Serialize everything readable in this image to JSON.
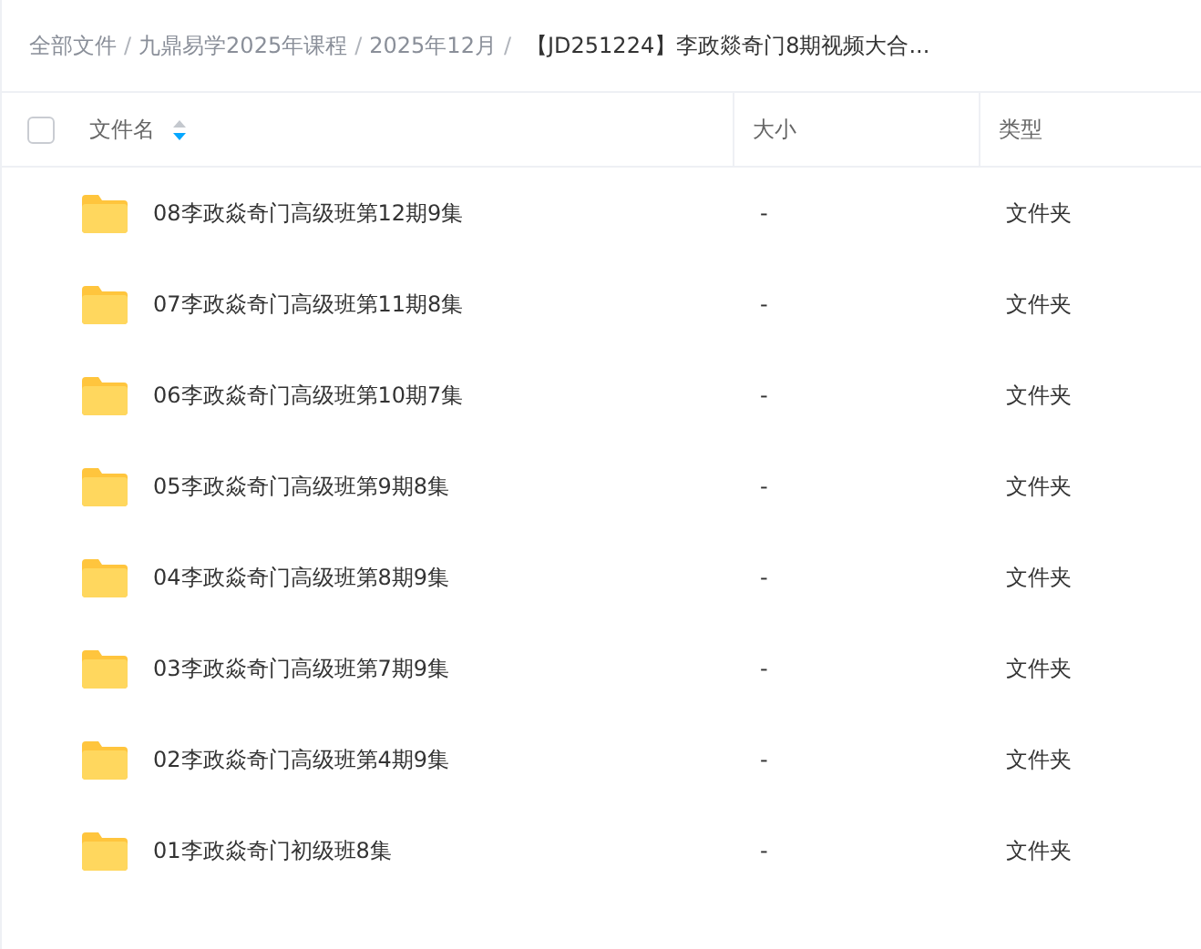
{
  "breadcrumb": [
    "全部文件",
    "九鼎易学2025年课程",
    "2025年12月"
  ],
  "breadcrumb_separator": "/",
  "breadcrumb_current": "【JD251224】李政燚奇门8期视频大合...",
  "table": {
    "select_all": {
      "checked": false
    },
    "columns": [
      {
        "label": "文件名"
      },
      {
        "label": "大小"
      },
      {
        "label": "类型"
      }
    ],
    "sort_descending": true,
    "rows": [
      {
        "name": "08李政焱奇门高级班第12期9集",
        "size": "-",
        "type": "文件夹"
      },
      {
        "name": "07李政焱奇门高级班第11期8集",
        "size": "-",
        "type": "文件夹"
      },
      {
        "name": "06李政焱奇门高级班第10期7集",
        "size": "-",
        "type": "文件夹"
      },
      {
        "name": "05李政焱奇门高级班第9期8集",
        "size": "-",
        "type": "文件夹"
      },
      {
        "name": "04李政焱奇门高级班第8期9集",
        "size": "-",
        "type": "文件夹"
      },
      {
        "name": "03李政焱奇门高级班第7期9集",
        "size": "-",
        "type": "文件夹"
      },
      {
        "name": "02李政焱奇门高级班第4期9集",
        "size": "-",
        "type": "文件夹"
      },
      {
        "name": "01李政焱奇门初级班8集",
        "size": "-",
        "type": "文件夹"
      }
    ]
  }
}
